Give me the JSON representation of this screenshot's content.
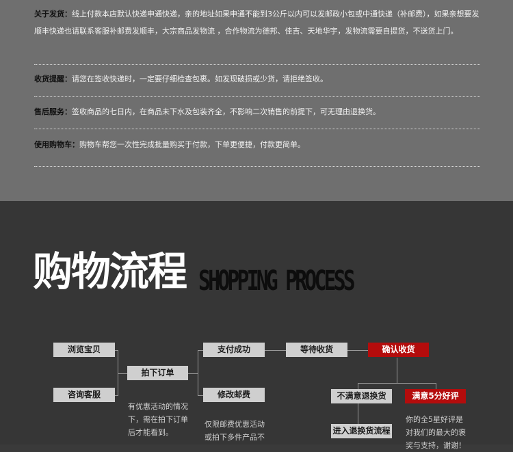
{
  "info": {
    "rows": [
      {
        "label": "关于发货：",
        "text": "线上付款本店默认快递申通快递，亲的地址如果申通不能到3公斤以内可以发邮政小包或中通快递（补邮费），如果亲想要发顺丰快递也请联系客服补邮费发顺丰，大宗商品发物流 ，合作物流为德邦、佳吉、天地华宇，发物流需要自提货，不送货上门。"
      },
      {
        "label": "收货提醒：",
        "text": "请您在签收快递时，一定要仔细检查包裹。如发现破损或少货，请拒绝签收。"
      },
      {
        "label": "售后服务：",
        "text": "签收商品的七日内，在商品未下水及包装齐全，不影响二次销售的前提下，可无理由退换货。"
      },
      {
        "label": "使用购物车：",
        "text": "购物车帮您一次性完成批量购买于付款，下单更便捷，付款更简单。"
      }
    ]
  },
  "process": {
    "title_cn": "购物流程",
    "title_en": "SHOPPING PROCESS",
    "steps": {
      "browse": "浏览宝贝",
      "consult": "咨询客服",
      "order": "拍下订单",
      "paid": "支付成功",
      "modify_postage": "修改邮费",
      "wait": "等待收货",
      "confirm": "确认收货",
      "unsatisfied": "不满意退换货",
      "five_star": "满意5分好评",
      "return_flow": "进入退换货流程"
    },
    "notes": {
      "order_note": "有优惠活动的情况下，需在拍下订单后才能看到。",
      "postage_note": "仅限邮费优惠活动或拍下多件产品不",
      "praise_note": "你的全5星好评是对我们的最大的褒奖与支持，谢谢！"
    }
  },
  "colors": {
    "accent": "#b40c0c",
    "header_bg": "#6f6f6f",
    "body_bg": "#363636"
  }
}
